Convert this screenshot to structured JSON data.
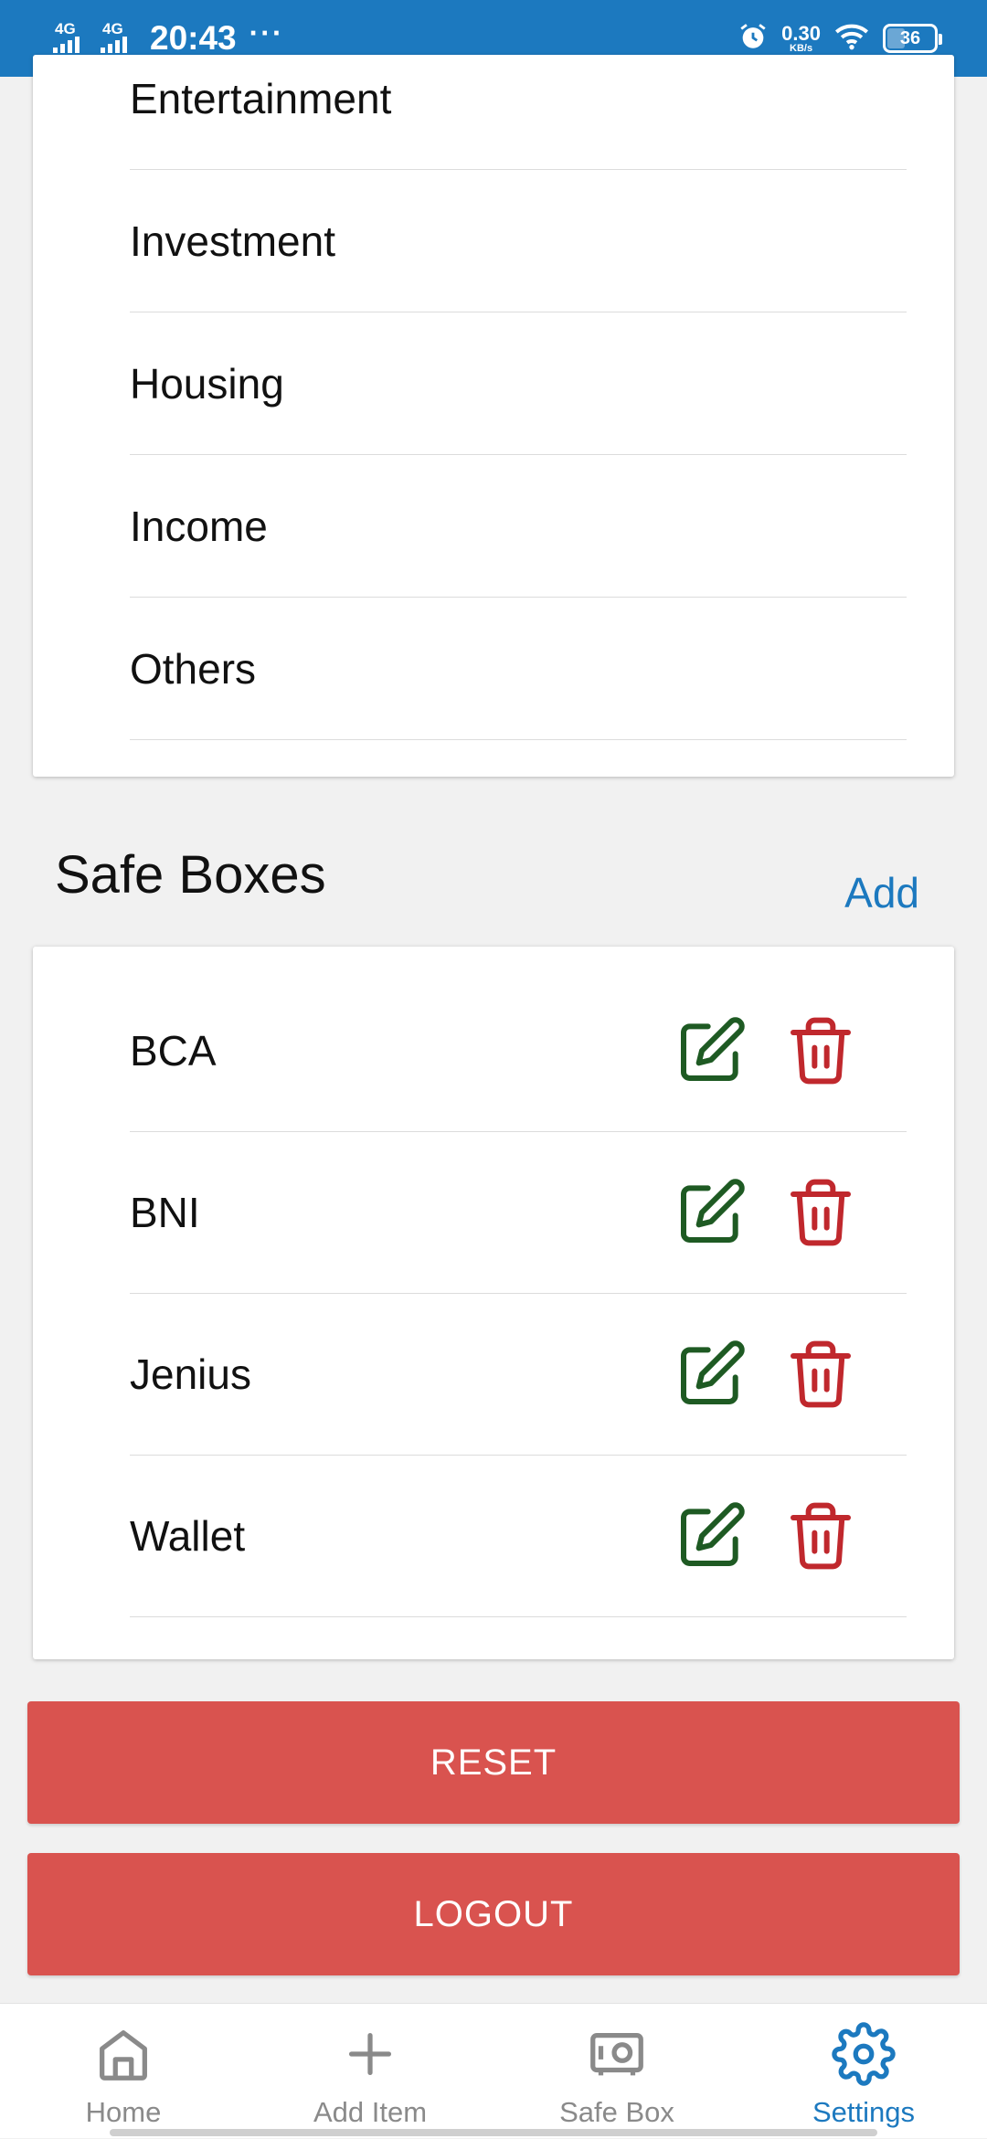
{
  "status_bar": {
    "network1": "4G",
    "network2": "4G",
    "time": "20:43",
    "more": "···",
    "speed_value": "0.30",
    "speed_unit": "KB/s",
    "battery": "36"
  },
  "categories": [
    {
      "label": "Entertainment"
    },
    {
      "label": "Investment"
    },
    {
      "label": "Housing"
    },
    {
      "label": "Income"
    },
    {
      "label": "Others"
    }
  ],
  "safe_boxes": {
    "title": "Safe Boxes",
    "add_label": "Add",
    "items": [
      {
        "name": "BCA"
      },
      {
        "name": "BNI"
      },
      {
        "name": "Jenius"
      },
      {
        "name": "Wallet"
      }
    ]
  },
  "buttons": {
    "reset": "RESET",
    "logout": "LOGOUT"
  },
  "bottom_nav": [
    {
      "label": "Home",
      "icon": "home-icon"
    },
    {
      "label": "Add Item",
      "icon": "plus-icon"
    },
    {
      "label": "Safe Box",
      "icon": "safe-icon"
    },
    {
      "label": "Settings",
      "icon": "gear-icon"
    }
  ],
  "colors": {
    "primary": "#1c79bf",
    "danger": "#d9534f",
    "edit_icon": "#1e5a23",
    "delete_icon": "#c0282d"
  }
}
